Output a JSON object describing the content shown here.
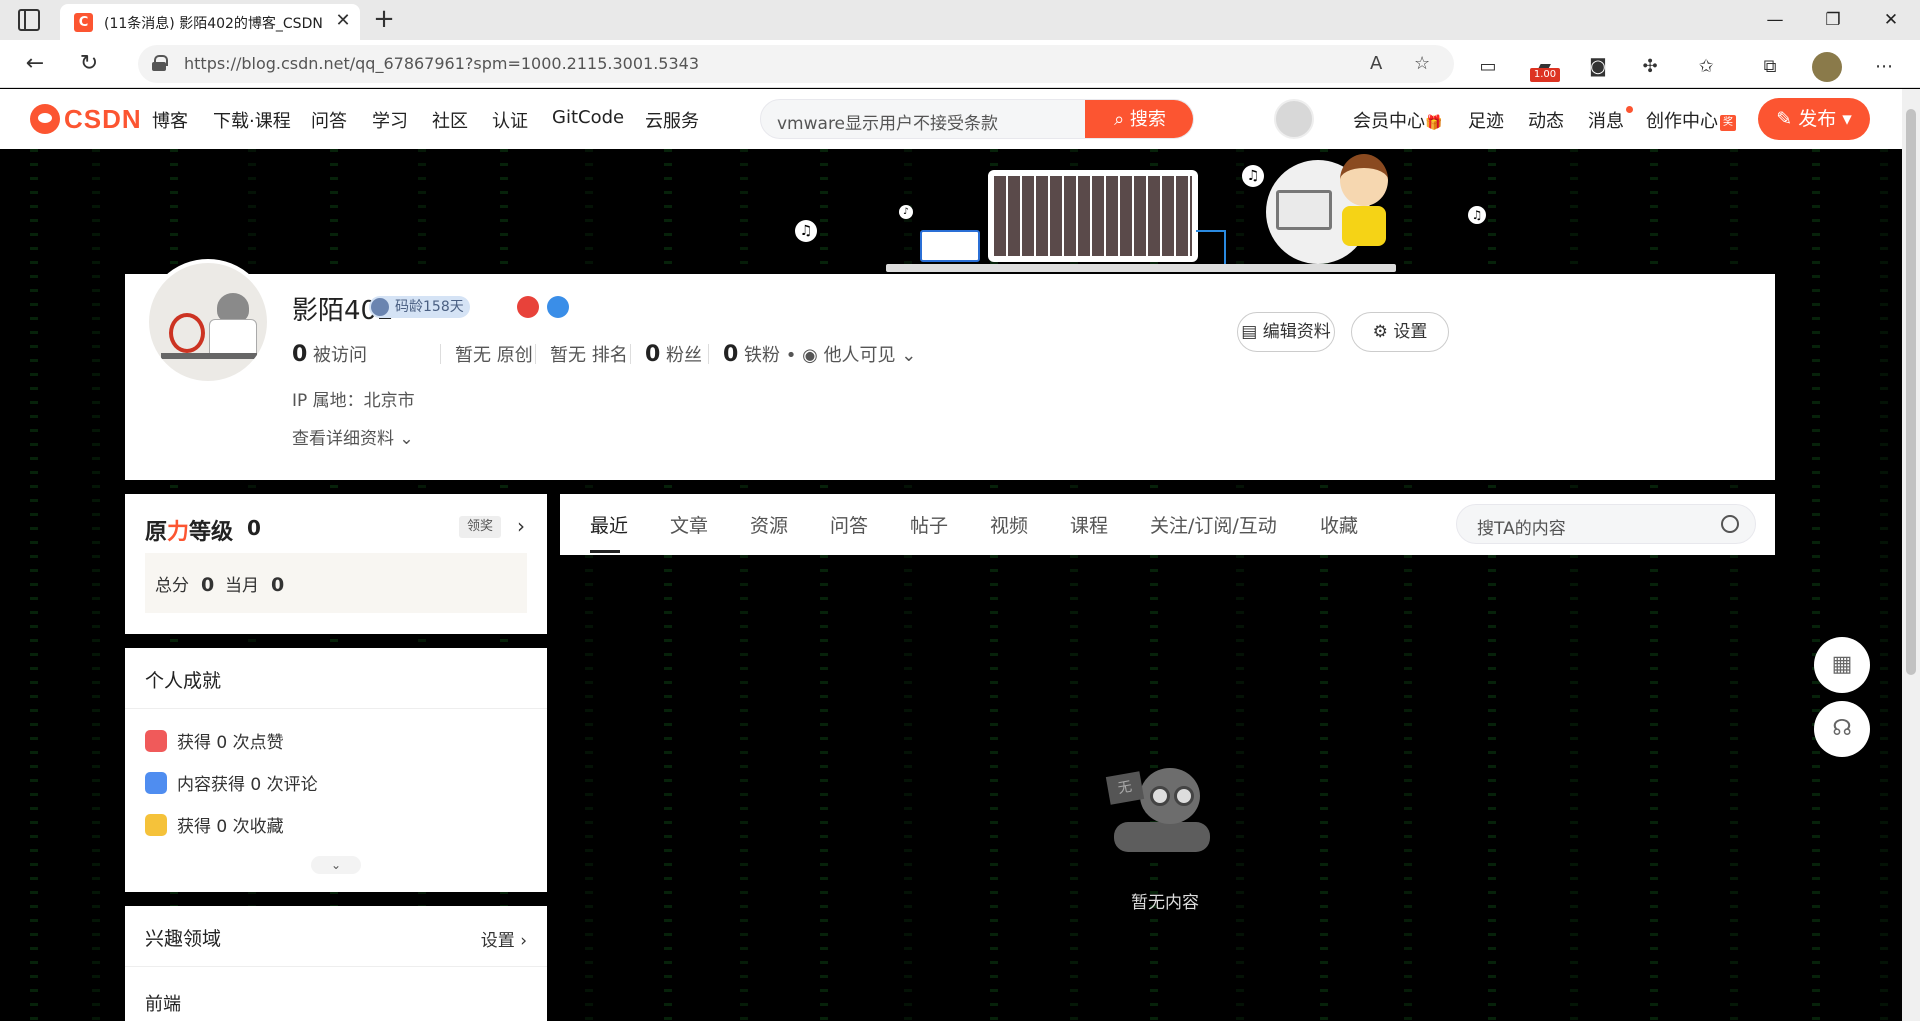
{
  "browser": {
    "tab_title": "(11条消息) 影陌402的博客_CSDN",
    "url": "https://blog.csdn.net/qq_67867961?spm=1000.2115.3001.5343",
    "ext_badge": "1.00"
  },
  "header": {
    "logo_text": "CSDN",
    "nav": [
      "博客",
      "下载·课程",
      "问答",
      "学习",
      "社区",
      "认证",
      "GitCode",
      "云服务"
    ],
    "search_value": "vmware显示用户不接受条款",
    "search_button": "搜索",
    "member": "会员中心",
    "footprint": "足迹",
    "dynamic": "动态",
    "messages": "消息",
    "creator": "创作中心",
    "creator_badge": "奖",
    "publish": "发布"
  },
  "profile": {
    "name": "影陌402",
    "coding_age": "码龄158天",
    "stats": {
      "visits_num": "0",
      "visits_label": "被访问",
      "original": "暂无 原创",
      "rank": "暂无 排名",
      "fans_num": "0",
      "fans_label": "粉丝",
      "iron_num": "0",
      "iron_label": "铁粉",
      "visibility": "他人可见"
    },
    "ip_label": "IP 属地：北京市",
    "detail_link": "查看详细资料",
    "edit_button": "编辑资料",
    "settings_button": "设置"
  },
  "level": {
    "title_a": "原",
    "title_b": "力",
    "title_c": "等级",
    "value": "0",
    "award": "领奖",
    "total_label": "总分",
    "total_value": "0",
    "month_label": "当月",
    "month_value": "0"
  },
  "achievements": {
    "title": "个人成就",
    "items": [
      "获得 0 次点赞",
      "内容获得 0 次评论",
      "获得 0 次收藏"
    ]
  },
  "interests": {
    "title": "兴趣领域",
    "settings": "设置",
    "items": [
      "前端"
    ]
  },
  "main_tabs": {
    "items": [
      "最近",
      "文章",
      "资源",
      "问答",
      "帖子",
      "视频",
      "课程",
      "关注/订阅/互动",
      "收藏"
    ],
    "search_placeholder": "搜TA的内容"
  },
  "empty": {
    "sign": "无",
    "text": "暂无内容"
  }
}
